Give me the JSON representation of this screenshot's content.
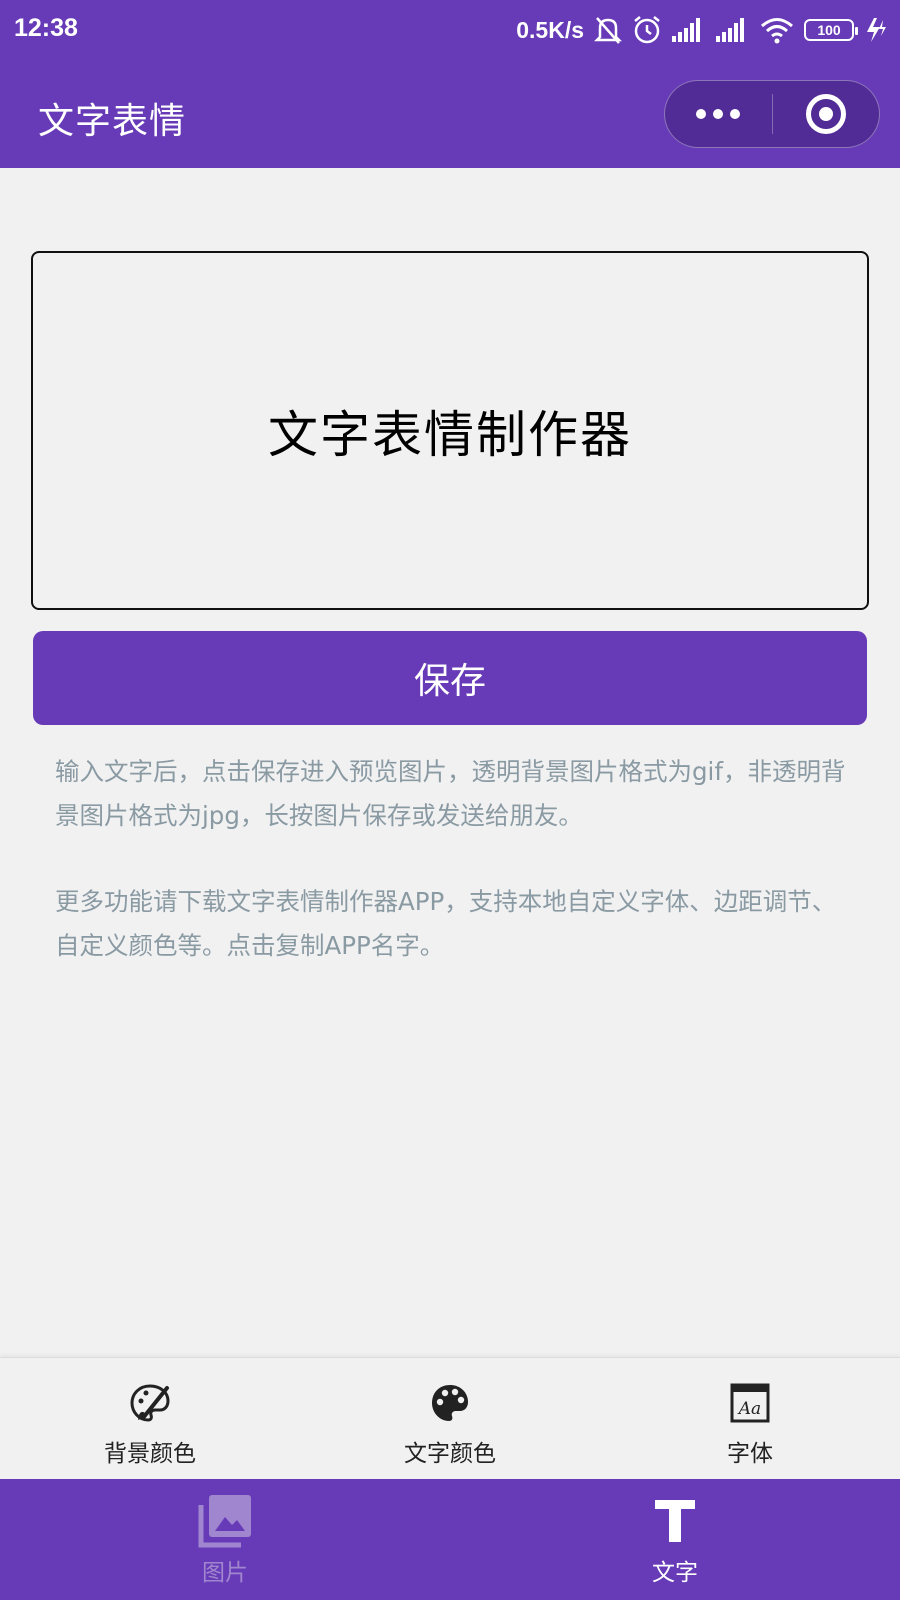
{
  "status_bar": {
    "time": "12:38",
    "net_speed": "0.5K/s",
    "battery": "100",
    "icons": [
      "bell-off-icon",
      "alarm-icon",
      "signal-icon",
      "signal-icon",
      "wifi-icon",
      "battery-icon",
      "charging-icon"
    ]
  },
  "nav": {
    "title": "文字表情",
    "more_icon": "more-dots-icon",
    "close_icon": "target-icon"
  },
  "preview": {
    "text": "文字表情制作器"
  },
  "save_label": "保存",
  "info": {
    "line1": "输入文字后，点击保存进入预览图片，透明背景图片格式为gif，非透明背景图片格式为jpg，长按图片保存或发送给朋友。",
    "line2": "更多功能请下载文字表情制作器APP，支持本地自定义字体、边距调节、自定义颜色等。点击复制APP名字。"
  },
  "toolbar": {
    "items": [
      {
        "label": "背景颜色",
        "icon": "paint-brush-icon"
      },
      {
        "label": "文字颜色",
        "icon": "palette-icon"
      },
      {
        "label": "字体",
        "icon": "font-icon"
      }
    ]
  },
  "tabbar": {
    "items": [
      {
        "label": "图片",
        "icon": "image-icon",
        "active": false
      },
      {
        "label": "文字",
        "icon": "text-icon",
        "active": true
      }
    ]
  },
  "colors": {
    "primary": "#673ab7",
    "background": "#f1f1f2",
    "info_text": "#8a9aa3",
    "tab_inactive": "#9f86cf"
  }
}
